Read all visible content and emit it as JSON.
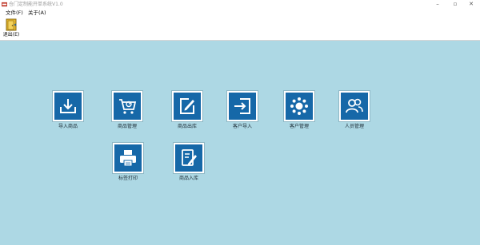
{
  "window": {
    "title": "仓门定制能开单系统V1.0",
    "minimize": "–",
    "maximize": "▫",
    "close": "✕"
  },
  "menu": [
    {
      "label": "文件(F)"
    },
    {
      "label": "关于(A)"
    }
  ],
  "toolbar": {
    "exit_label": "退出(E)",
    "exit_icon": "exit-door-icon"
  },
  "colors": {
    "workspace": "#add8e4",
    "tile_accent": "#1668a8"
  },
  "tiles": [
    {
      "label": "导入商品",
      "icon": "download-tray-icon"
    },
    {
      "label": "商品管理",
      "icon": "shopping-cart-icon"
    },
    {
      "label": "商品出库",
      "icon": "edit-document-icon"
    },
    {
      "label": "客户导入",
      "icon": "import-arrow-icon"
    },
    {
      "label": "客户管理",
      "icon": "dots-ring-icon"
    },
    {
      "label": "人员管理",
      "icon": "users-icon"
    },
    {
      "label": "标签打印",
      "icon": "printer-icon"
    },
    {
      "label": "商品入库",
      "icon": "document-pen-icon"
    }
  ]
}
